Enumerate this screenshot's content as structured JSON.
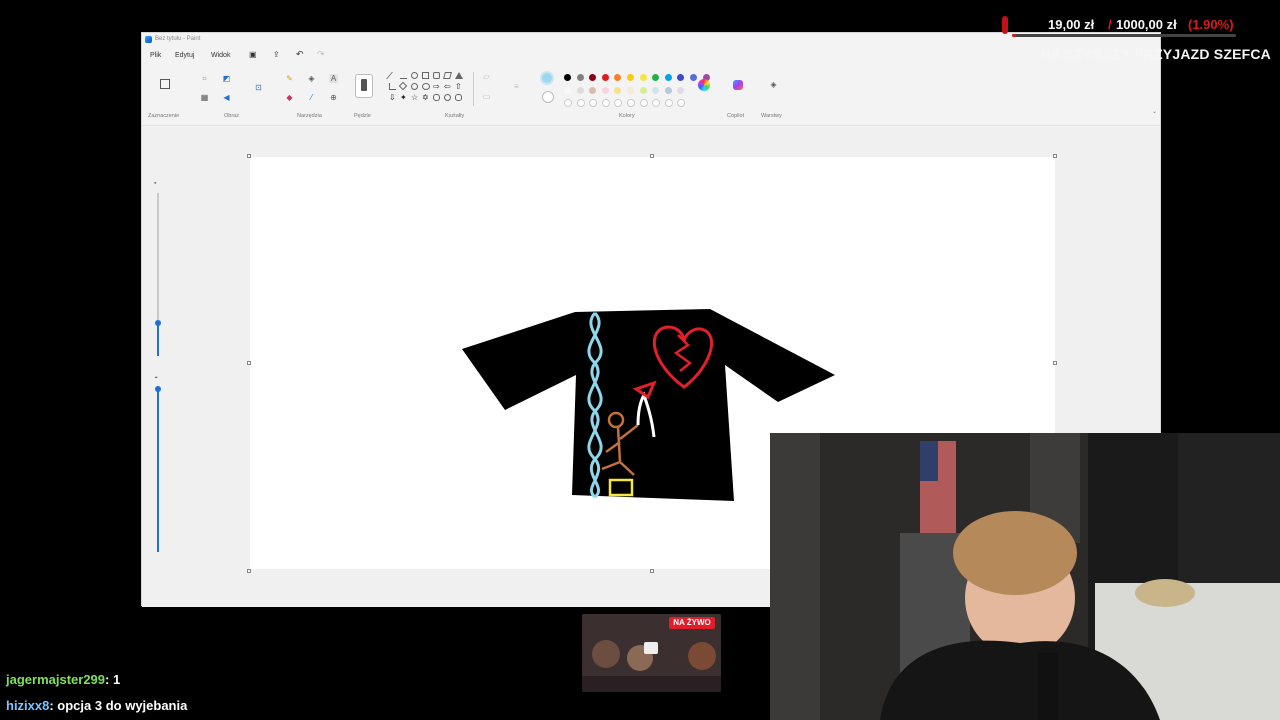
{
  "paint": {
    "title": "Bez tytułu - Paint",
    "menu": [
      "Plik",
      "Edytuj",
      "Widok"
    ],
    "groups": {
      "selection": "Zaznaczenie",
      "image": "Obraz",
      "tools": "Narzędzia",
      "brushes": "Pędzle",
      "shapes": "Kształty",
      "colors": "Kolory",
      "copilot": "Copilot",
      "layers": "Warstwy"
    },
    "palette": [
      "#000000",
      "#7f7f7f",
      "#880015",
      "#d81e1e",
      "#ff7f27",
      "#ffc90e",
      "#f5e642",
      "#22b14c",
      "#00a2e8",
      "#3f48cc",
      "#5b6bd6",
      "#a349a4"
    ],
    "palette_row2": [
      "#ffffff",
      "#c3c3c3",
      "#b97a57",
      "#ffaec9",
      "#ffc90e",
      "#efe4b0",
      "#b5e61d",
      "#99d9ea",
      "#7092be",
      "#c8bfe7"
    ],
    "active_color": "#9fd8ee",
    "slider_brush_size": 0.2,
    "slider_opacity": 1.0
  },
  "overlay": {
    "donation_current": "19,00 zł",
    "donation_separator": "/",
    "donation_goal": "1000,00 zł",
    "donation_percent": "(1.90%)",
    "donation_progress": 0.019,
    "goal_title": "NA SZYBSZY PRZYJAZD SZEFCA",
    "live_badge": "NA ŻYWO"
  },
  "chat": [
    {
      "user": "jagermajster299",
      "message": ": 1"
    },
    {
      "user": "hizixx8",
      "message": ": opcja 3 do wyjebania"
    }
  ],
  "colors": {
    "accent": "#1f6fd8",
    "donation_red": "#e01818",
    "chat_user1": "#7ee05a",
    "chat_user2": "#7cc4ff"
  }
}
